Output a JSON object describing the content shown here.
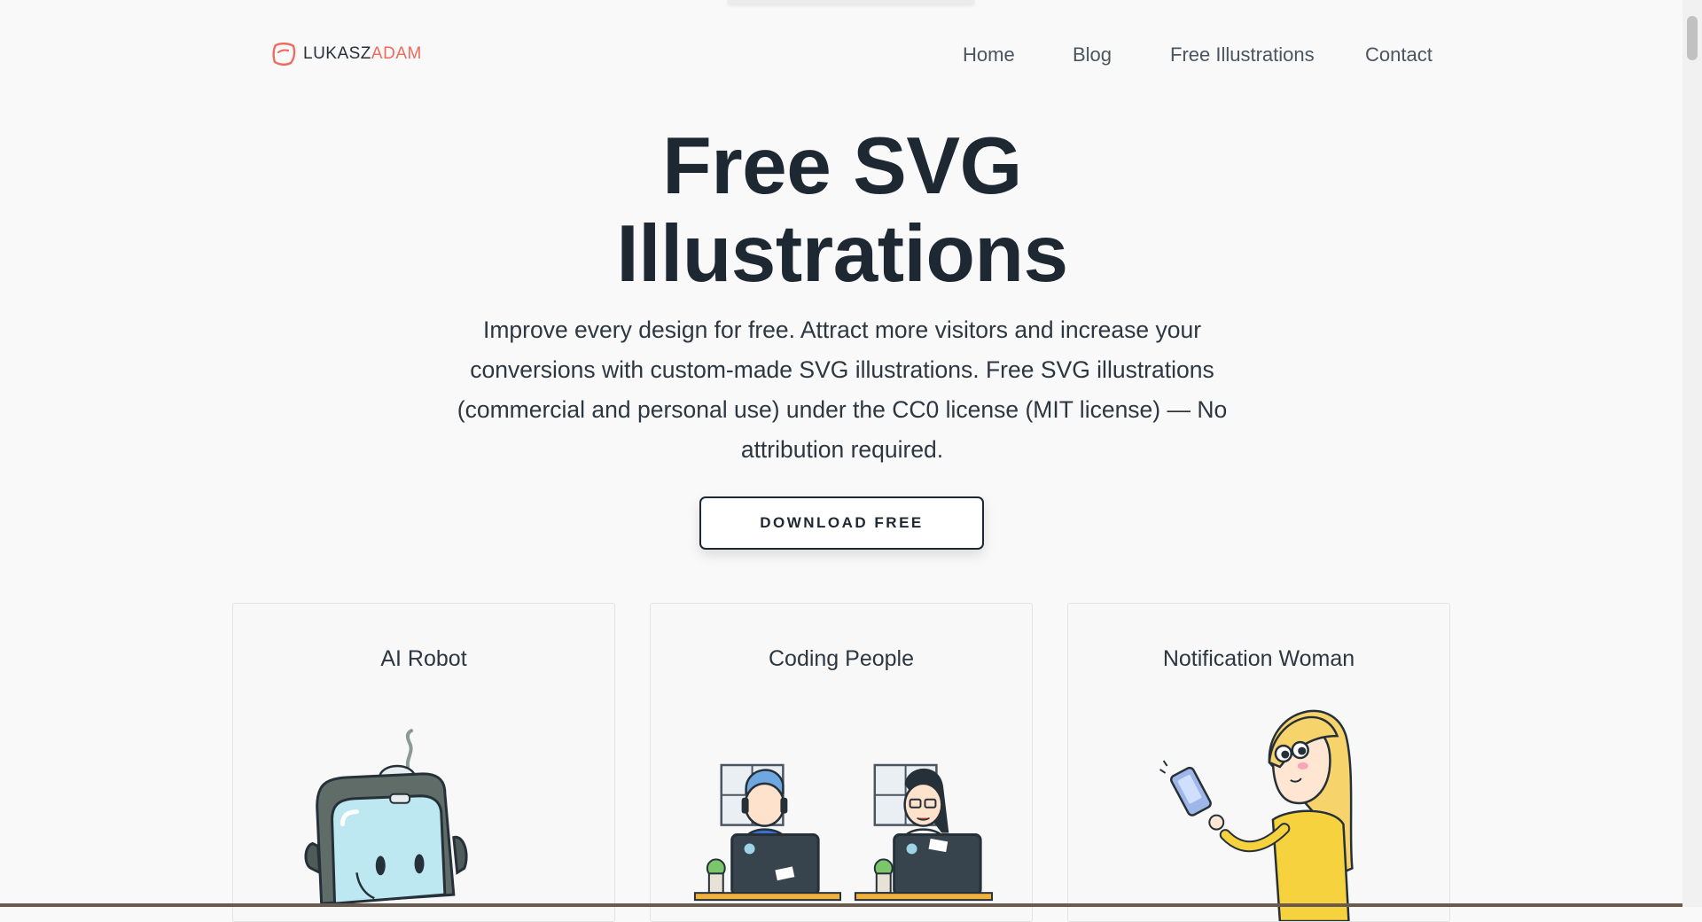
{
  "header": {
    "logo_first": "LUKASZ",
    "logo_second": "ADAM",
    "nav": [
      {
        "label": "Home"
      },
      {
        "label": "Blog"
      },
      {
        "label": "Free Illustrations"
      },
      {
        "label": "Contact"
      }
    ]
  },
  "hero": {
    "title_line1": "Free SVG",
    "title_line2": "Illustrations",
    "description": "Improve every design for free. Attract more visitors and increase your conversions with custom-made SVG illustrations. Free SVG illustrations (commercial and personal use) under the CC0 license (MIT license) — No attribution required.",
    "cta_label": "DOWNLOAD FREE"
  },
  "cards": [
    {
      "title": "AI Robot",
      "icon": "robot-illustration"
    },
    {
      "title": "Coding People",
      "icon": "coding-people-illustration"
    },
    {
      "title": "Notification Woman",
      "icon": "notification-woman-illustration"
    }
  ],
  "colors": {
    "accent": "#f06a5d",
    "text_dark": "#1e2832",
    "background": "#f9f9f9"
  }
}
